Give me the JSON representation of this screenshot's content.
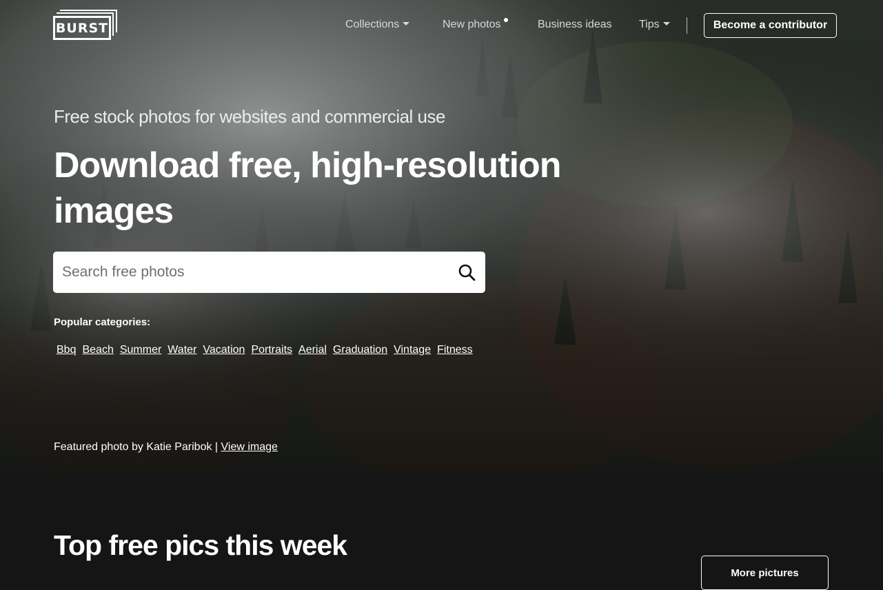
{
  "brand": {
    "logo_text": "BURST"
  },
  "nav": {
    "collections_label": "Collections",
    "new_photos_label": "New photos",
    "business_ideas_label": "Business ideas",
    "tips_label": "Tips",
    "contributor_button": "Become a contributor"
  },
  "hero": {
    "tagline": "Free stock photos for websites and commercial use",
    "headline": "Download free, high-resolution images",
    "search_placeholder": "Search free photos",
    "popular_label": "Popular categories:",
    "categories": [
      "Bbq",
      "Beach",
      "Summer",
      "Water",
      "Vacation",
      "Portraits",
      "Aerial",
      "Graduation",
      "Vintage",
      "Fitness"
    ],
    "credit_text": "Featured photo by Katie Paribok |",
    "credit_link": "View image"
  },
  "section": {
    "title": "Top free pics this week",
    "more_button": "More pictures"
  },
  "colors": {
    "page_background": "#151515",
    "forest_dark": "#2c302b",
    "foliage_red": "#7a3a2a",
    "mist": "#d4d6d8"
  }
}
